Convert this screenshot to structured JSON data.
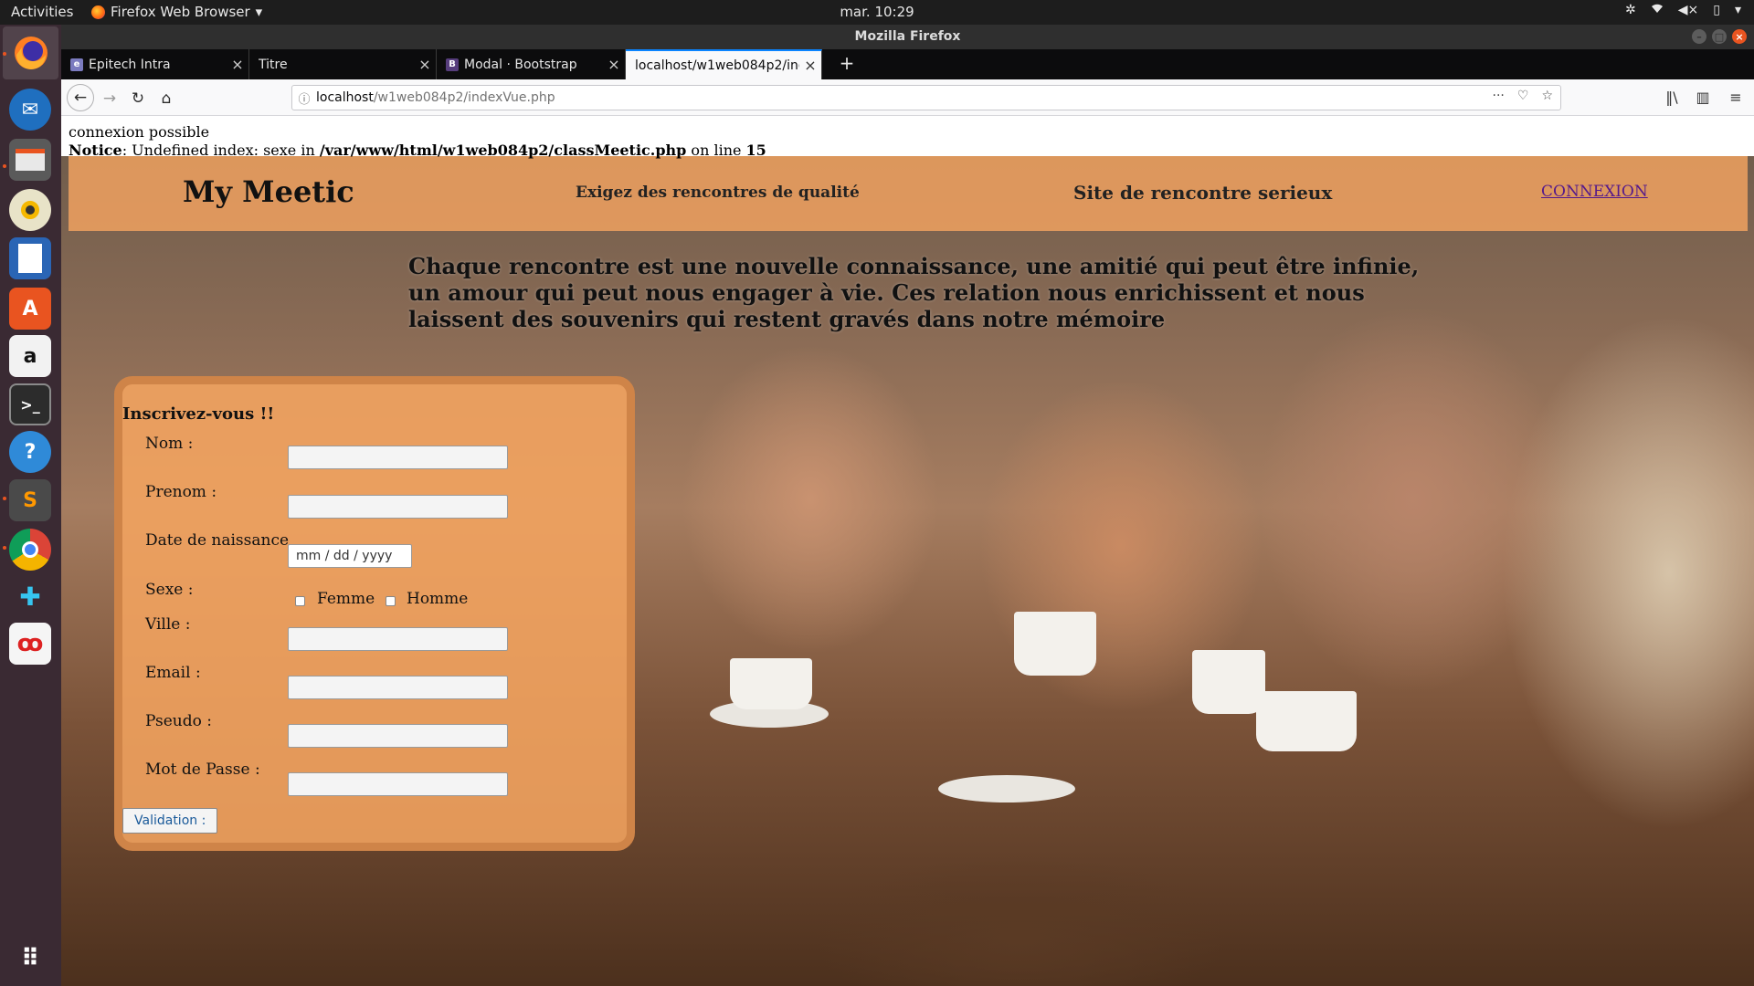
{
  "topbar": {
    "activities": "Activities",
    "app_name": "Firefox Web Browser",
    "clock": "mar. 10:29"
  },
  "window": {
    "title": "Mozilla Firefox"
  },
  "tabs": [
    {
      "label": "Epitech Intra",
      "favicon": "e"
    },
    {
      "label": "Titre",
      "favicon": ""
    },
    {
      "label": "Modal · Bootstrap",
      "favicon": "B"
    },
    {
      "label": "localhost/w1web084p2/inde",
      "favicon": ""
    }
  ],
  "urlbar": {
    "host": "localhost",
    "path": "/w1web084p2/indexVue.php"
  },
  "php_output": {
    "line1": "connexion possible",
    "notice_label": "Notice",
    "notice_text": ": Undefined index: sexe in ",
    "notice_file": "/var/www/html/w1web084p2/classMeetic.php",
    "notice_on": " on line ",
    "notice_line": "15"
  },
  "header": {
    "brand": "My Meetic",
    "tagline": "Exigez des rencontres de qualité",
    "tagline2": "Site de rencontre serieux",
    "login": "CONNEXION"
  },
  "hero": {
    "text": "Chaque rencontre est une nouvelle connaissance, une amitié qui peut être infinie, un amour qui peut nous engager à vie. Ces relation nous enrichissent et nous laissent des souvenirs qui restent gravés dans notre mémoire"
  },
  "form": {
    "title": "Inscrivez-vous !!",
    "nom": "Nom :",
    "prenom": "Prenom :",
    "date": "Date de naissance",
    "date_placeholder": "mm / dd / yyyy",
    "sexe": "Sexe :",
    "femme": "Femme",
    "homme": "Homme",
    "ville": "Ville :",
    "email": "Email :",
    "pseudo": "Pseudo :",
    "password": "Mot de Passe :",
    "submit": "Validation :"
  }
}
